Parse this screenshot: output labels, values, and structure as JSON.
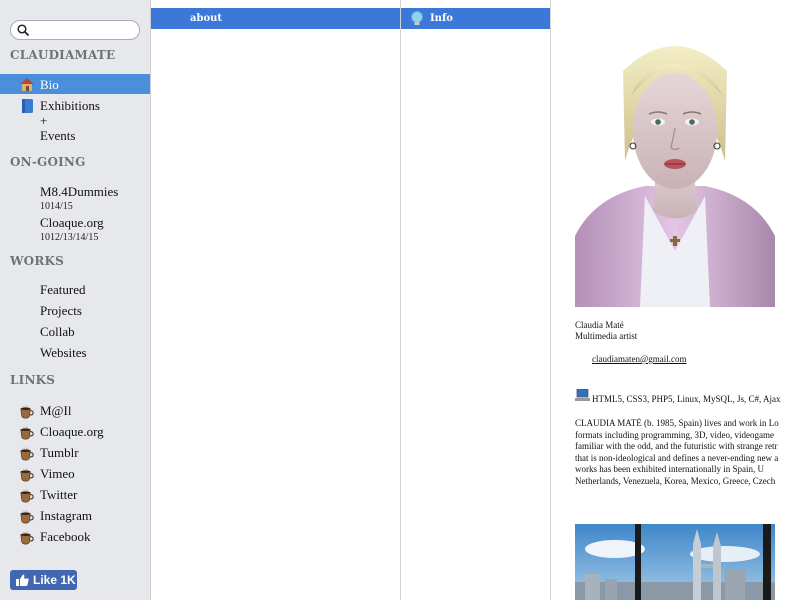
{
  "search": {
    "placeholder": ""
  },
  "sidebar": {
    "site_title": "CLAUDIAMATE",
    "main_items": [
      {
        "label": "Bio",
        "icon": "house-icon",
        "active": true
      },
      {
        "label": "Exhibitions",
        "label2": "+",
        "label3": "Events",
        "icon": "book-icon"
      }
    ],
    "ongoing": {
      "heading": "ON-GOING",
      "items": [
        {
          "label": "M8.4Dummies",
          "sub": "1014/15"
        },
        {
          "label": "Cloaque.org",
          "sub": "1012/13/14/15"
        }
      ]
    },
    "works": {
      "heading": "WORKS",
      "items": [
        "Featured",
        "Projects",
        "Collab",
        "Websites"
      ]
    },
    "links": {
      "heading": "LINKS",
      "items": [
        "M@Il",
        "Cloaque.org",
        "Tumblr",
        "Vimeo",
        "Twitter",
        "Instagram",
        "Facebook"
      ],
      "icon": "coffee-cup-icon"
    },
    "facebook_like": {
      "label": "Like 1K",
      "color": "#4267b2"
    }
  },
  "columns": {
    "about_tab": "about",
    "info_tab": "Info",
    "tab_color": "#3b78d8"
  },
  "content": {
    "name": "Claudia Maté",
    "role": "Multimedia artist",
    "email": "claudiamaten@gmail.com",
    "skills": "HTML5, CSS3, PHP5, Linux, MySQL, Js, C#, Ajax",
    "bio_lines": [
      "CLAUDIA MATÉ (b. 1985, Spain) lives and work in Lo",
      "formats including programming, 3D, video, videogame",
      "familiar with the odd, and the futuristic with strange retr",
      "that is non-ideological and defines a never-ending new a",
      "works has been exhibited internationally in Spain, U",
      "Netherlands, Venezuela, Korea, Mexico, Greece, Czech"
    ]
  },
  "colors": {
    "sidebar_bg": "#e7e8ec",
    "active_item": "#4a8fdc",
    "heading_gray": "#6f7378"
  }
}
